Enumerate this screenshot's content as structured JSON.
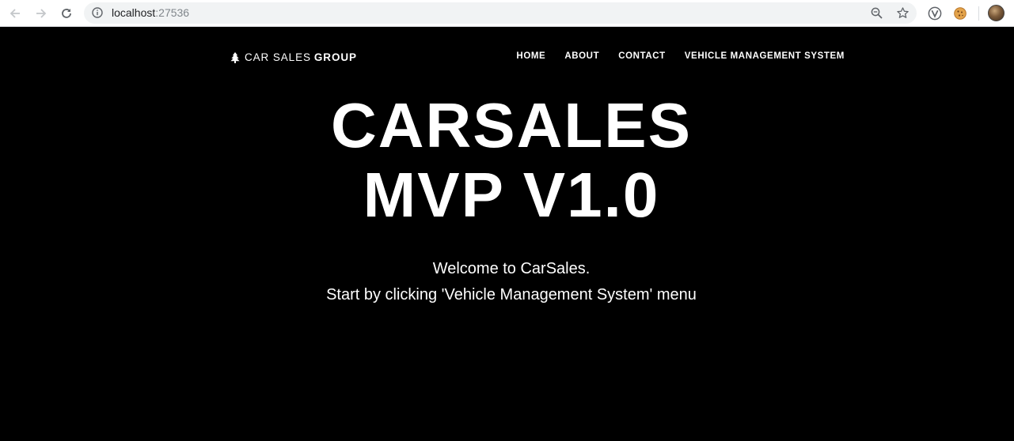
{
  "browser": {
    "url_host": "localhost",
    "url_port": ":27536"
  },
  "navbar": {
    "brand_light": "CAR SALES",
    "brand_bold": "GROUP",
    "menu": [
      {
        "label": "HOME"
      },
      {
        "label": "ABOUT"
      },
      {
        "label": "CONTACT"
      },
      {
        "label": "VEHICLE MANAGEMENT SYSTEM"
      }
    ]
  },
  "hero": {
    "title_line1": "CARSALES",
    "title_line2": "MVP V1.0",
    "welcome_line1": "Welcome to CarSales.",
    "welcome_line2": "Start by clicking 'Vehicle Management System' menu"
  }
}
